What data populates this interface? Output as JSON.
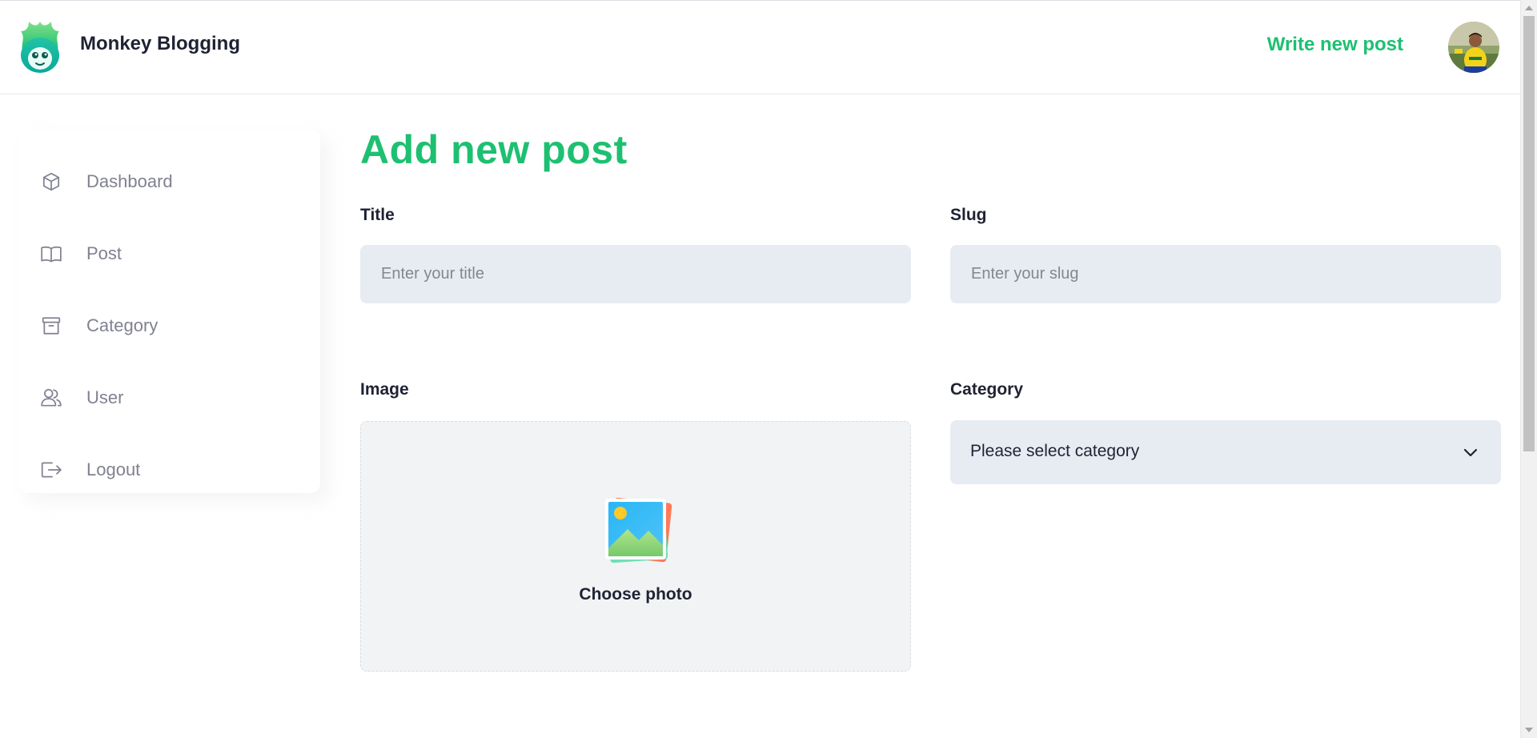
{
  "header": {
    "brand": "Monkey Blogging",
    "write_link": "Write new post"
  },
  "sidebar": {
    "items": [
      {
        "label": "Dashboard",
        "icon": "cube-icon"
      },
      {
        "label": "Post",
        "icon": "book-icon"
      },
      {
        "label": "Category",
        "icon": "archive-icon"
      },
      {
        "label": "User",
        "icon": "users-icon"
      },
      {
        "label": "Logout",
        "icon": "logout-icon"
      }
    ]
  },
  "main": {
    "title": "Add new post",
    "fields": {
      "title": {
        "label": "Title",
        "placeholder": "Enter your title",
        "value": ""
      },
      "slug": {
        "label": "Slug",
        "placeholder": "Enter your slug",
        "value": ""
      },
      "image": {
        "label": "Image",
        "button": "Choose photo"
      },
      "category": {
        "label": "Category",
        "selected": "Please select category"
      }
    }
  },
  "colors": {
    "accent": "#1dc071",
    "input_bg": "#e7ecf3",
    "muted_text": "#808191"
  }
}
